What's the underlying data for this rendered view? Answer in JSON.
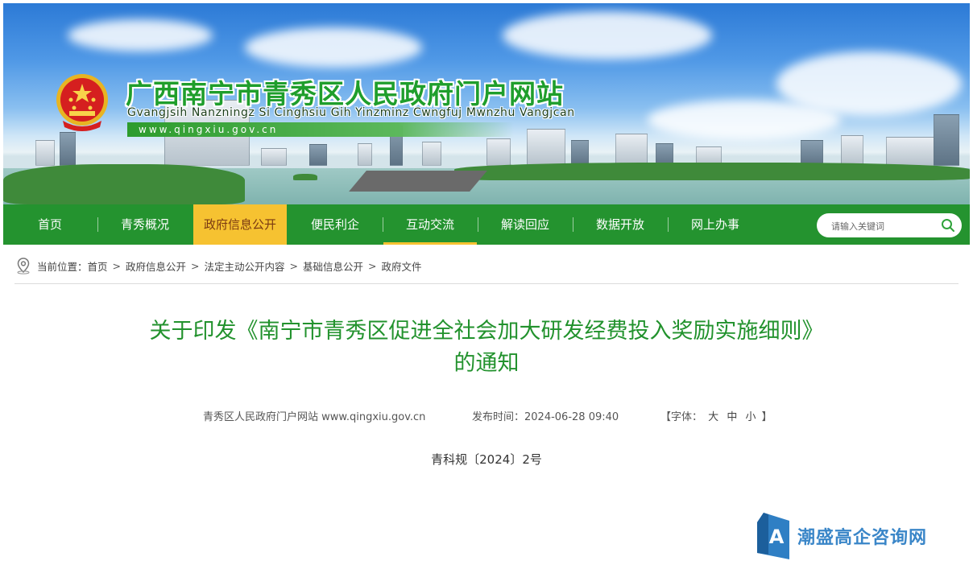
{
  "header": {
    "site_title": "广西南宁市青秀区人民政府门户网站",
    "site_subtitle": "Gvangjsih Nanzningz Si Cinghsiu Gih Yinzminz Cwngfuj Mwnzhu Vangjcan",
    "site_url": "www.qingxiu.gov.cn"
  },
  "nav": {
    "items": [
      {
        "label": "首页"
      },
      {
        "label": "青秀概况"
      },
      {
        "label": "政府信息公开"
      },
      {
        "label": "便民利企"
      },
      {
        "label": "互动交流"
      },
      {
        "label": "解读回应"
      },
      {
        "label": "数据开放"
      },
      {
        "label": "网上办事"
      }
    ],
    "active_index": 2,
    "search_placeholder": "请输入关键词"
  },
  "breadcrumb": {
    "prefix": "当前位置：",
    "items": [
      "首页",
      "政府信息公开",
      "法定主动公开内容",
      "基础信息公开",
      "政府文件"
    ],
    "separator": ">"
  },
  "article": {
    "title_line1": "关于印发《南宁市青秀区促进全社会加大研发经费投入奖励实施细则》",
    "title_line2": "的通知",
    "source": "青秀区人民政府门户网站 www.qingxiu.gov.cn",
    "publish_label": "发布时间：",
    "publish_time": "2024-06-28 09:40",
    "font_label_open": "【字体：",
    "font_large": "大",
    "font_medium": "中",
    "font_small": "小",
    "font_label_close": "】",
    "doc_number": "青科规〔2024〕2号"
  },
  "watermark": {
    "text": "潮盛高企咨询网",
    "logo_letter": "A"
  },
  "colors": {
    "nav_green": "#24932f",
    "title_green": "#22922d",
    "active_yellow": "#f6c231",
    "watermark_blue": "#3a86c8"
  },
  "icons": {
    "emblem": "national-emblem-icon",
    "search": "search-icon",
    "location": "location-pin-icon",
    "watermark_logo": "watermark-logo-icon"
  }
}
